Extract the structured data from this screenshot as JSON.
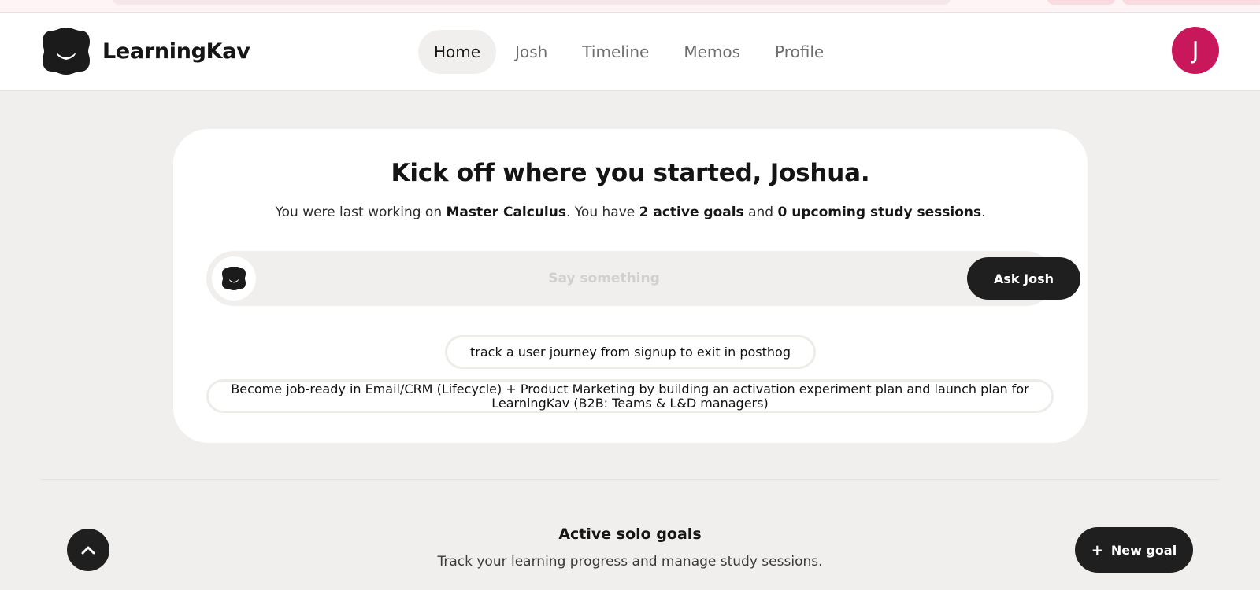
{
  "header": {
    "brand_name": "LearningKav",
    "nav": [
      {
        "label": "Home",
        "active": true
      },
      {
        "label": "Josh",
        "active": false
      },
      {
        "label": "Timeline",
        "active": false
      },
      {
        "label": "Memos",
        "active": false
      },
      {
        "label": "Profile",
        "active": false
      }
    ],
    "avatar_initial": "J",
    "avatar_color": "#c8175b"
  },
  "hero": {
    "title": "Kick off where you started, Joshua.",
    "subtitle": {
      "part1": "You were last working on ",
      "last_goal": "Master Calculus",
      "part2": ". You have ",
      "active_goals": "2 active goals",
      "part3": " and ",
      "sessions": "0 upcoming study sessions",
      "part4": "."
    },
    "ask": {
      "placeholder": "Say something",
      "button_label": "Ask Josh"
    },
    "suggestions": [
      "track a user journey from signup to exit in posthog",
      "Become job-ready in Email/CRM (Lifecycle) + Product Marketing by building an activation experiment plan and launch plan for LearningKav (B2B: Teams & L&D managers)"
    ]
  },
  "goals": {
    "title": "Active solo goals",
    "subtitle": "Track your learning progress and manage study sessions.",
    "new_goal_icon": "+",
    "new_goal_label": "New goal"
  },
  "icons": {
    "logo": "smile-blob-icon",
    "scroll_top": "chevron-up-icon"
  },
  "colors": {
    "dark": "#1f1f1f",
    "page_background": "#f0efed",
    "accent_avatar": "#c8175b"
  }
}
